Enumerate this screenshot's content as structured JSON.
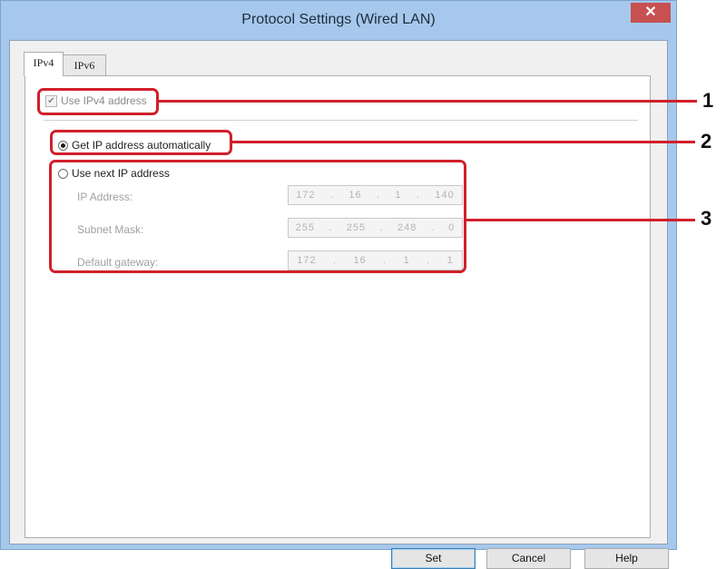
{
  "window": {
    "title": "Protocol Settings (Wired LAN)",
    "close_glyph": "✕"
  },
  "tabs": [
    {
      "label": "IPv4",
      "active": true
    },
    {
      "label": "IPv6",
      "active": false
    }
  ],
  "ipv4": {
    "use_ipv4_label": "Use IPv4 address",
    "use_ipv4_checked": true,
    "use_ipv4_enabled": false,
    "auto_ip_label": "Get IP address automatically",
    "auto_ip_selected": true,
    "manual_ip_label": "Use next IP address",
    "manual_ip_selected": false,
    "fields": [
      {
        "label": "IP Address:",
        "octets": [
          "172",
          "16",
          "1",
          "140"
        ]
      },
      {
        "label": "Subnet Mask:",
        "octets": [
          "255",
          "255",
          "248",
          "0"
        ]
      },
      {
        "label": "Default gateway:",
        "octets": [
          "172",
          "16",
          "1",
          "1"
        ]
      }
    ]
  },
  "callouts": [
    "1",
    "2",
    "3"
  ],
  "buttons": {
    "set": "Set",
    "cancel": "Cancel",
    "help": "Help"
  },
  "colors": {
    "callout": "#d0202a",
    "titlebar": "#a6c8ec",
    "close_button": "#c75050"
  }
}
